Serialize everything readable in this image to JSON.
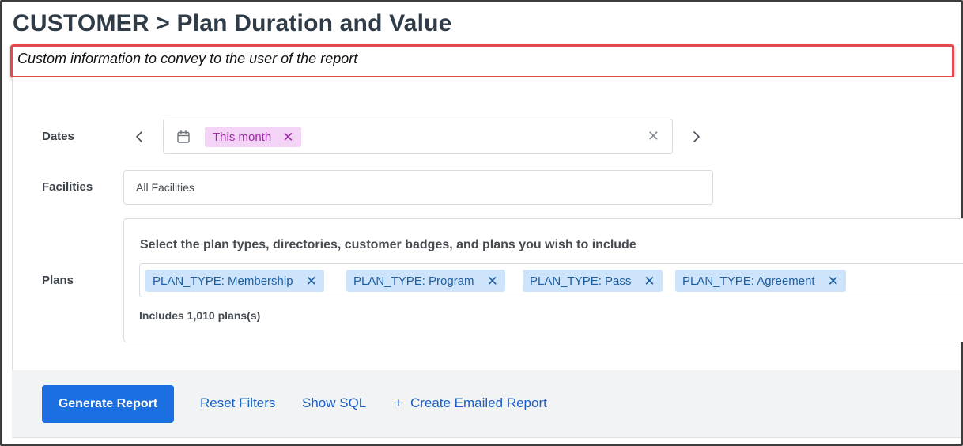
{
  "header": {
    "title": "CUSTOMER > Plan Duration and Value",
    "info_text": "Custom information to convey to the user of the report"
  },
  "filters": {
    "dates": {
      "label": "Dates",
      "selected_chip": "This month",
      "prev_icon": "chevron-left-icon",
      "next_icon": "chevron-right-icon",
      "calendar_icon": "calendar-icon"
    },
    "facilities": {
      "label": "Facilities",
      "value": "All Facilities"
    },
    "plans": {
      "label": "Plans",
      "prompt": "Select the plan types, directories, customer badges, and plans you wish to include",
      "chips": [
        "PLAN_TYPE: Membership",
        "PLAN_TYPE: Program",
        "PLAN_TYPE: Pass",
        "PLAN_TYPE: Agreement"
      ],
      "count_text": "Includes 1,010 plans(s)"
    }
  },
  "footer": {
    "generate_label": "Generate Report",
    "reset_label": "Reset Filters",
    "sql_label": "Show SQL",
    "emailed_label": "Create Emailed Report"
  },
  "colors": {
    "primary": "#1b6fe0",
    "link": "#1c5fc6",
    "date_chip_bg": "#f3d4f6",
    "date_chip_text": "#9b2aa3",
    "plan_chip_bg": "#cde4fb",
    "plan_chip_text": "#1f5e9e",
    "highlight_border": "#e5484d"
  }
}
